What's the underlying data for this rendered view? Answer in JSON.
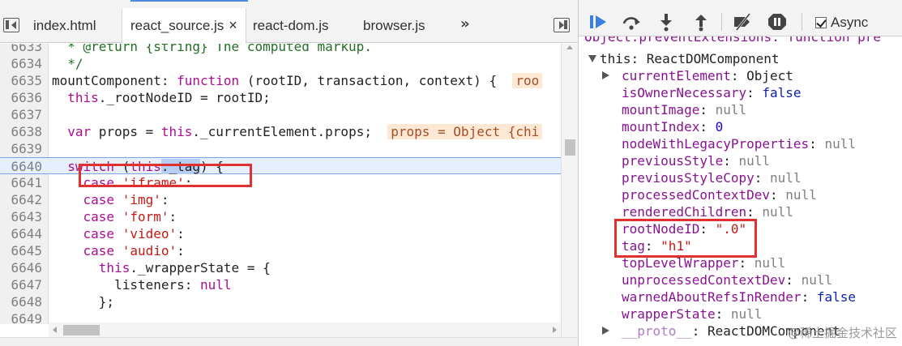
{
  "tabs": [
    {
      "label": "index.html"
    },
    {
      "label": "react_source.js",
      "close": "×"
    },
    {
      "label": "react-dom.js"
    },
    {
      "label": "browser.js"
    }
  ],
  "more_tabs": "»",
  "code_lines": [
    {
      "n": "6633",
      "html": "<span class=\"cm\">  * @return {string} The computed markup.</span>"
    },
    {
      "n": "6634",
      "html": "<span class=\"cm\">  */</span>"
    },
    {
      "n": "6635",
      "html": "mountComponent: <span class=\"kw\">function</span> (rootID, transaction, context) {  <span class=\"inline-val\">roo</span>"
    },
    {
      "n": "6636",
      "html": "  <span class=\"kw\">this</span>._rootNodeID = rootID;"
    },
    {
      "n": "6637",
      "html": ""
    },
    {
      "n": "6638",
      "html": "  <span class=\"kw\">var</span> props = <span class=\"kw\">this</span>._currentElement.props;  <span class=\"inline-val\">props = Object {chi</span>"
    },
    {
      "n": "6639",
      "html": ""
    },
    {
      "n": "6640",
      "html": "  <span class=\"kw\">switch</span> (<span class=\"kw\">this</span><span class=\"sel\">._tag</span>) {",
      "highlight": true
    },
    {
      "n": "6641",
      "html": "    <span class=\"kw\">case</span> <span class=\"str\">'iframe'</span>:"
    },
    {
      "n": "6642",
      "html": "    <span class=\"kw\">case</span> <span class=\"str\">'img'</span>:"
    },
    {
      "n": "6643",
      "html": "    <span class=\"kw\">case</span> <span class=\"str\">'form'</span>:"
    },
    {
      "n": "6644",
      "html": "    <span class=\"kw\">case</span> <span class=\"str\">'video'</span>:"
    },
    {
      "n": "6645",
      "html": "    <span class=\"kw\">case</span> <span class=\"str\">'audio'</span>:"
    },
    {
      "n": "6646",
      "html": "      <span class=\"kw\">this</span>._wrapperState = {"
    },
    {
      "n": "6647",
      "html": "        listeners: <span class=\"kw\">null</span>"
    },
    {
      "n": "6648",
      "html": "      };"
    },
    {
      "n": "6649",
      "html": ""
    }
  ],
  "toolbar": {
    "async_label": "Async"
  },
  "scope": {
    "partial_top": "Object.preventExtensions: function pre",
    "root_label": "this: ReactDOMComponent",
    "props": [
      {
        "name": "currentElement",
        "value": "Object",
        "type": "obj",
        "expandable": true
      },
      {
        "name": "isOwnerNecessary",
        "value": "false",
        "type": "kw"
      },
      {
        "name": "mountImage",
        "value": "null",
        "type": "null"
      },
      {
        "name": "mountIndex",
        "value": "0",
        "type": "num"
      },
      {
        "name": "nodeWithLegacyProperties",
        "value": "null",
        "type": "null"
      },
      {
        "name": "previousStyle",
        "value": "null",
        "type": "null"
      },
      {
        "name": "previousStyleCopy",
        "value": "null",
        "type": "null"
      },
      {
        "name": "processedContextDev",
        "value": "null",
        "type": "null"
      },
      {
        "name": "renderedChildren",
        "value": "null",
        "type": "null"
      },
      {
        "name": "rootNodeID",
        "value": "\".0\"",
        "type": "str"
      },
      {
        "name": "tag",
        "value": "\"h1\"",
        "type": "str"
      },
      {
        "name": "topLevelWrapper",
        "value": "null",
        "type": "null"
      },
      {
        "name": "unprocessedContextDev",
        "value": "null",
        "type": "null"
      },
      {
        "name": "warnedAboutRefsInRender",
        "value": "false",
        "type": "kw"
      },
      {
        "name": "wrapperState",
        "value": "null",
        "type": "null"
      }
    ],
    "proto_name": "__proto__",
    "proto_value": "ReactDOMComponent"
  },
  "watermark": "@稀土掘金技术社区"
}
